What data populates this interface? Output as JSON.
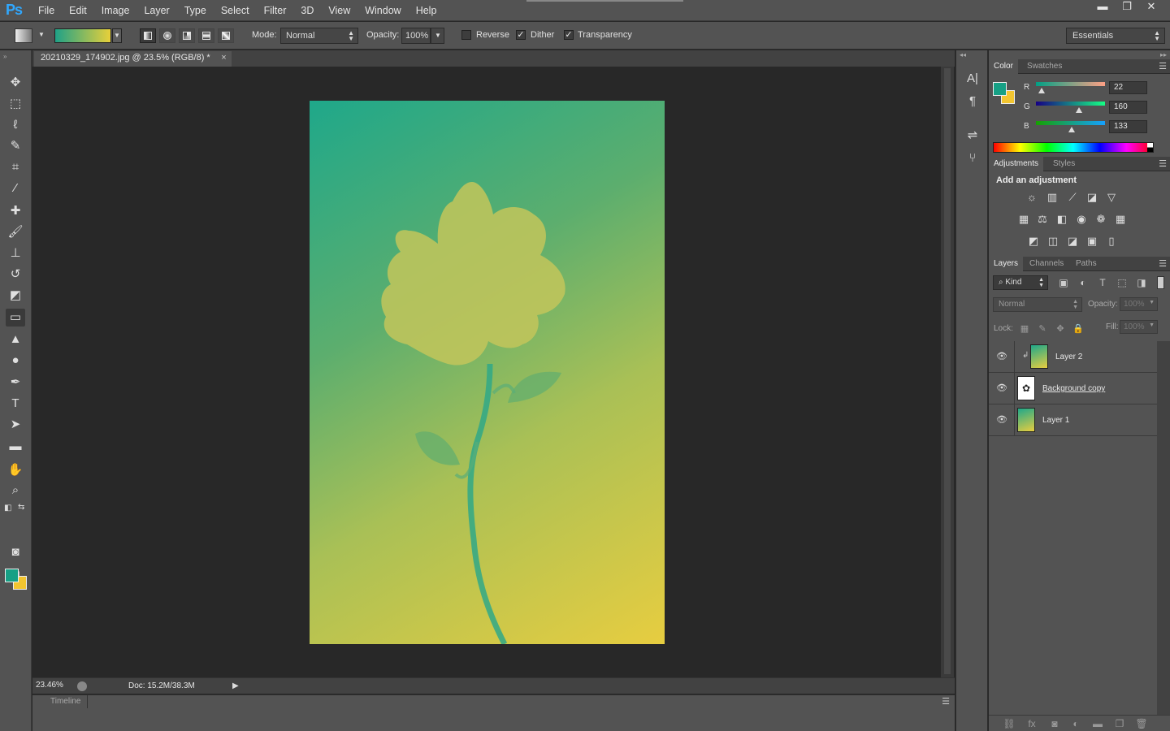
{
  "app": {
    "logo": "Ps"
  },
  "menu": [
    "File",
    "Edit",
    "Image",
    "Layer",
    "Type",
    "Select",
    "Filter",
    "3D",
    "View",
    "Window",
    "Help"
  ],
  "window_controls": {
    "minimize": "▬",
    "restore": "❐",
    "close": "✕"
  },
  "options": {
    "mode_label": "Mode:",
    "mode_value": "Normal",
    "opacity_label": "Opacity:",
    "opacity_value": "100%",
    "reverse_label": "Reverse",
    "dither_label": "Dither",
    "transparency_label": "Transparency",
    "reverse_checked": false,
    "dither_checked": true,
    "transparency_checked": true,
    "workspace": "Essentials",
    "gradient_colors": [
      "#1fa187",
      "#e8d03a"
    ]
  },
  "document": {
    "tab_title": "20210329_174902.jpg @ 23.5% (RGB/8) *",
    "close": "×",
    "zoom": "23.46%",
    "doc_info": "Doc: 15.2M/38.3M"
  },
  "timeline": {
    "tab": "Timeline"
  },
  "color_panel": {
    "tabs": [
      "Color",
      "Swatches"
    ],
    "fg_color": "#16a085",
    "bg_color": "#f2c530",
    "r_label": "R",
    "g_label": "G",
    "b_label": "B",
    "r": "22",
    "g": "160",
    "b": "133"
  },
  "adjustments_panel": {
    "tabs": [
      "Adjustments",
      "Styles"
    ],
    "title": "Add an adjustment"
  },
  "layers_panel": {
    "tabs": [
      "Layers",
      "Channels",
      "Paths"
    ],
    "filter": "Kind",
    "blend_mode": "Normal",
    "opacity_label": "Opacity:",
    "opacity_value": "100%",
    "lock_label": "Lock:",
    "fill_label": "Fill:",
    "fill_value": "100%",
    "layers": [
      {
        "name": "Layer 2",
        "clipped": true
      },
      {
        "name": "Background copy",
        "clipped": false
      },
      {
        "name": "Layer 1",
        "clipped": false
      }
    ]
  }
}
